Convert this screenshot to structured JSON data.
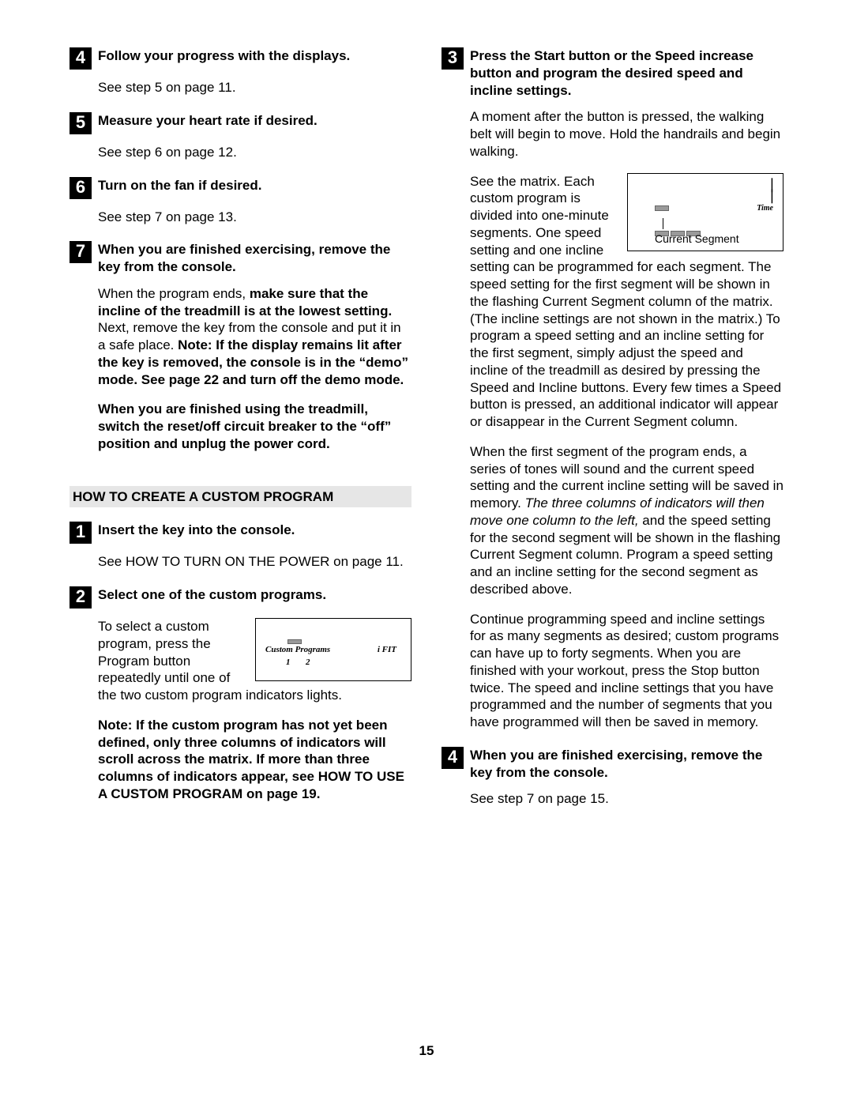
{
  "left": {
    "s4": {
      "n": "4",
      "title": "Follow your progress with the displays.",
      "body": "See step 5 on page 11."
    },
    "s5": {
      "n": "5",
      "title": "Measure your heart rate if desired.",
      "body": "See step 6 on page 12."
    },
    "s6": {
      "n": "6",
      "title": "Turn on the fan if desired.",
      "body": "See step 7 on page 13."
    },
    "s7": {
      "n": "7",
      "title": "When you are finished exercising, remove the key from the console.",
      "p1a": "When the program ends, ",
      "p1b": "make sure that the incline of the treadmill is at the lowest setting.",
      "p1c": " Next, remove the key from the console and put it in a safe place. ",
      "p1d": "Note: If the display remains lit after the key is removed, the console is in the “demo” mode. See page 22 and turn off the demo mode.",
      "p2": "When you are finished using the treadmill, switch the reset/off circuit breaker to the “off” position and unplug the power cord."
    },
    "heading": "HOW TO CREATE A CUSTOM PROGRAM",
    "c1": {
      "n": "1",
      "title": "Insert the key into the console.",
      "body": "See HOW TO TURN ON THE POWER on page 11."
    },
    "c2": {
      "n": "2",
      "title": "Select one of the custom programs.",
      "p1": "To select a custom program, press the Program button repeatedly until one of the two custom program indicators lights.",
      "p2": "Note: If the custom program has not yet been defined, only three columns of indicators will scroll across the matrix. If more than three columns of indicators appear, see HOW TO USE A CUSTOM PROGRAM on page 19."
    },
    "diag1": {
      "cp": "Custom Programs",
      "ifit": "i FIT",
      "n1": "1",
      "n2": "2"
    }
  },
  "right": {
    "s3": {
      "n": "3",
      "title": "Press the Start button or the Speed increase button and program the desired speed and incline settings.",
      "p1": "A moment after the button is pressed, the walking belt will begin to move. Hold the handrails and begin walking.",
      "p2": "See the matrix. Each custom program is divided into one-minute segments. One speed setting and one incline setting can be programmed for each segment. The speed setting for the first segment will be shown in the flashing Current Segment column of the matrix. (The incline settings are not shown in the matrix.) To program a speed setting and an incline setting for the first segment, simply adjust the speed and incline of the treadmill as desired by pressing the Speed and Incline buttons. Every few times a Speed button is pressed, an additional indicator will appear or disappear in the Current Segment column.",
      "p3a": "When the first segment of the program ends, a series of tones will sound and the current speed setting and the current incline setting will be saved in memory. ",
      "p3b": "The three columns of indicators will then move one column to the left,",
      "p3c": " and the speed setting for the second segment will be shown in the flashing Current Segment column. Program a speed setting and an incline setting for the second segment as described above.",
      "p4": "Continue programming speed and incline settings for as many segments as desired; custom programs can have up to forty segments. When you are finished with your workout, press the Stop button twice. The speed and incline settings that you have programmed and the number of segments that you have programmed will then be saved in memory."
    },
    "diag2": {
      "time": "Time",
      "cs": "Current Segment"
    },
    "s4": {
      "n": "4",
      "title": "When you are finished exercising, remove the key from the console.",
      "body": "See step 7 on page 15."
    }
  },
  "page": "15"
}
